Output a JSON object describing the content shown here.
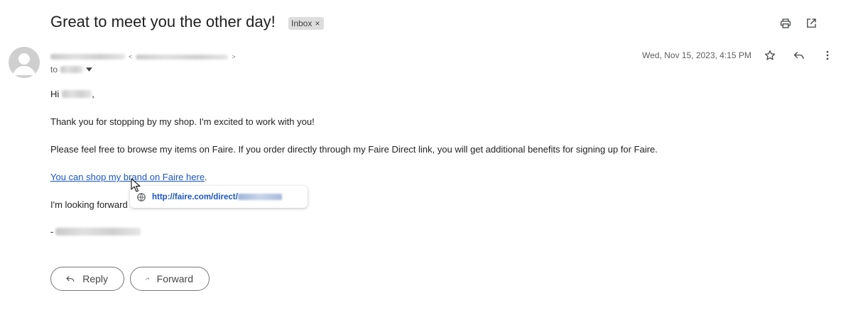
{
  "email": {
    "subject": "Great to meet you the other day!",
    "label": "Inbox",
    "label_close": "×",
    "sender_separator_open": "<",
    "sender_separator_close": ">",
    "to_prefix": "to",
    "date": "Wed, Nov 15, 2023, 4:15 PM",
    "body": {
      "greeting_prefix": "Hi",
      "greeting_suffix": ",",
      "line1": "Thank you for stopping by my shop. I'm excited to work with you!",
      "line2": "Please feel free to browse my items on Faire. If you order directly through my Faire Direct link, you will get additional benefits for signing up for Faire.",
      "link_text": "You can shop my brand on Faire here",
      "link_suffix": ".",
      "line3": "I'm looking forward",
      "signoff_prefix": "-"
    },
    "link_tooltip": {
      "url": "http://faire.com/direct/"
    }
  },
  "actions": {
    "reply_label": "Reply",
    "forward_label": "Forward"
  },
  "icons": {
    "header": [
      "print-icon",
      "open-in-new-window-icon"
    ],
    "message": [
      "star-icon",
      "reply-icon",
      "more-vert-icon"
    ],
    "tooltip": "globe-icon",
    "cursor": "mouse-pointer-icon"
  }
}
